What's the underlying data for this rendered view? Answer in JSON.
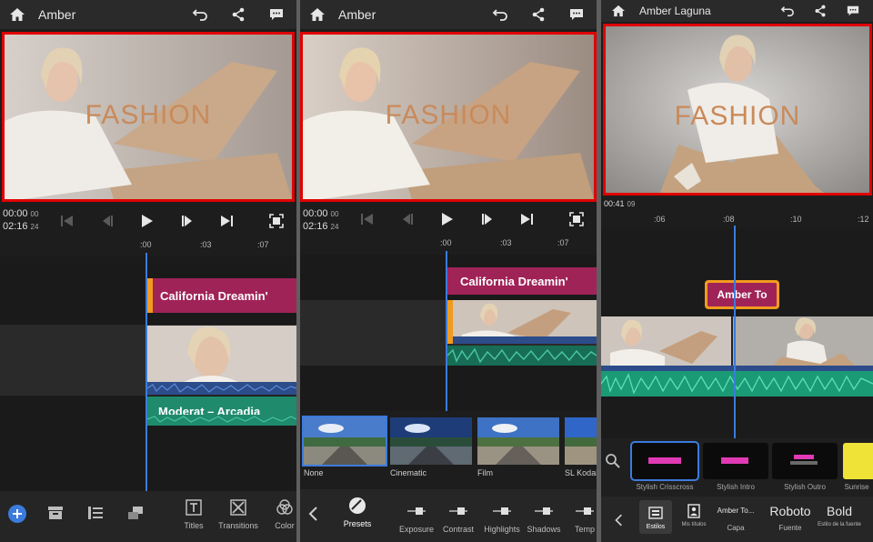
{
  "panels": [
    {
      "project_title": "Amber",
      "preview_overlay": "FASHION",
      "timecode_current": "00:00",
      "timecode_current_frames": "00",
      "timecode_total": "02:16",
      "timecode_fps": "24",
      "ruler_ticks": [
        ":00",
        ":03",
        ":07"
      ],
      "title_clip": "California Dreamin'",
      "audio_clip": "Moderat – Arcadia",
      "tools": [
        "Titles",
        "Transitions",
        "Color"
      ]
    },
    {
      "project_title": "Amber",
      "preview_overlay": "FASHION",
      "timecode_current": "00:00",
      "timecode_current_frames": "00",
      "timecode_total": "02:16",
      "timecode_fps": "24",
      "ruler_ticks": [
        ":00",
        ":03",
        ":07"
      ],
      "title_clip": "California Dreamin'",
      "filters": [
        "None",
        "Cinematic",
        "Film",
        "SL Kodak"
      ],
      "adjust_tools": [
        "Presets",
        "Exposure",
        "Contrast",
        "Highlights",
        "Shadows",
        "Temp"
      ]
    },
    {
      "project_title": "Amber Laguna",
      "preview_overlay": "FASHION",
      "timecode_current": "00:41",
      "timecode_current_frames": "09",
      "ruler_ticks": ":06|:08|:10|:12",
      "title_clip": "Amber To",
      "styles": [
        "Stylish Crisscross",
        "Stylish Intro",
        "Stylish Outro",
        "Sunrise"
      ],
      "text_tools": [
        {
          "label": "Estilos",
          "value": ""
        },
        {
          "label": "Mis títulos",
          "value": ""
        },
        {
          "label": "Capa",
          "value": "Amber To..."
        },
        {
          "label": "Fuente",
          "value": "Roboto"
        },
        {
          "label": "Estilo de la fuente",
          "value": "Bold"
        }
      ]
    }
  ],
  "colors": {
    "accent_blue": "#3b7bdc",
    "title_clip": "#a02358",
    "audio_clip": "#1f8a6c",
    "clip_handle": "#f29a1e",
    "highlight_border": "#e00000"
  }
}
